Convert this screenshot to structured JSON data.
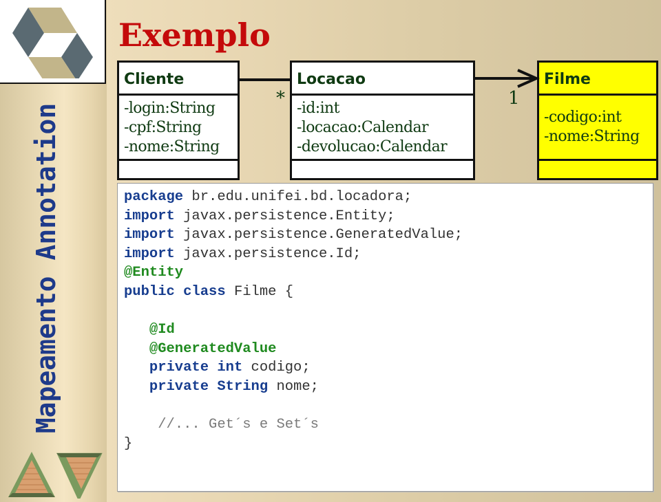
{
  "slide": {
    "title": "Exemplo",
    "section_title": "Mapeamento Annotation",
    "colors": {
      "title": "#c40a0a",
      "section_title": "#1e3a8a",
      "uml_text": "#0f3a12",
      "highlight_class": "#ffff00",
      "keyword": "#173d8f",
      "annotation": "#1f8a1f",
      "comment": "#7a7a7a"
    }
  },
  "sidebar": {
    "logo_icon": "hexagonal-cube-logo-icon",
    "nav": {
      "prev_icon": "triangle-up-icon",
      "next_icon": "triangle-down-icon"
    }
  },
  "uml": {
    "classes": [
      {
        "name": "Cliente",
        "attributes": [
          "-login:String",
          "-cpf:String",
          "-nome:String"
        ],
        "highlighted": false
      },
      {
        "name": "Locacao",
        "attributes": [
          "-id:int",
          "-locacao:Calendar",
          "-devolucao:Calendar"
        ],
        "highlighted": false
      },
      {
        "name": "Filme",
        "attributes": [
          "-codigo:int",
          "-nome:String"
        ],
        "highlighted": true
      }
    ],
    "associations": [
      {
        "from": "Cliente",
        "to": "Locacao",
        "multiplicity_to": "*"
      },
      {
        "from": "Locacao",
        "to": "Filme",
        "multiplicity_to": "1",
        "navigable": true
      }
    ]
  },
  "code": {
    "lines": [
      {
        "parts": [
          {
            "t": "package",
            "c": "kw"
          },
          {
            "t": " br.edu.unifei.bd.locadora;",
            "c": "plain"
          }
        ]
      },
      {
        "parts": [
          {
            "t": "import",
            "c": "kw"
          },
          {
            "t": " javax.persistence.Entity;",
            "c": "plain"
          }
        ]
      },
      {
        "parts": [
          {
            "t": "import",
            "c": "kw"
          },
          {
            "t": " javax.persistence.GeneratedValue;",
            "c": "plain"
          }
        ]
      },
      {
        "parts": [
          {
            "t": "import",
            "c": "kw"
          },
          {
            "t": " javax.persistence.Id;",
            "c": "plain"
          }
        ]
      },
      {
        "parts": [
          {
            "t": "@Entity",
            "c": "an"
          }
        ]
      },
      {
        "parts": [
          {
            "t": "public",
            "c": "kw"
          },
          {
            "t": " ",
            "c": "plain"
          },
          {
            "t": "class",
            "c": "kw"
          },
          {
            "t": " Filme {",
            "c": "plain"
          }
        ]
      },
      {
        "parts": [
          {
            "t": "",
            "c": "plain"
          }
        ]
      },
      {
        "parts": [
          {
            "t": "   ",
            "c": "plain"
          },
          {
            "t": "@Id",
            "c": "an"
          }
        ]
      },
      {
        "parts": [
          {
            "t": "   ",
            "c": "plain"
          },
          {
            "t": "@GeneratedValue",
            "c": "an"
          }
        ]
      },
      {
        "parts": [
          {
            "t": "   ",
            "c": "plain"
          },
          {
            "t": "private",
            "c": "kw"
          },
          {
            "t": " ",
            "c": "plain"
          },
          {
            "t": "int",
            "c": "kw"
          },
          {
            "t": " codigo;",
            "c": "plain"
          }
        ]
      },
      {
        "parts": [
          {
            "t": "   ",
            "c": "plain"
          },
          {
            "t": "private",
            "c": "kw"
          },
          {
            "t": " ",
            "c": "plain"
          },
          {
            "t": "String",
            "c": "kw"
          },
          {
            "t": " nome;",
            "c": "plain"
          }
        ]
      },
      {
        "parts": [
          {
            "t": "",
            "c": "plain"
          }
        ]
      },
      {
        "parts": [
          {
            "t": "    ",
            "c": "plain"
          },
          {
            "t": "//... Get´s e Set´s",
            "c": "cm"
          }
        ]
      },
      {
        "parts": [
          {
            "t": "}",
            "c": "plain"
          }
        ]
      }
    ]
  }
}
